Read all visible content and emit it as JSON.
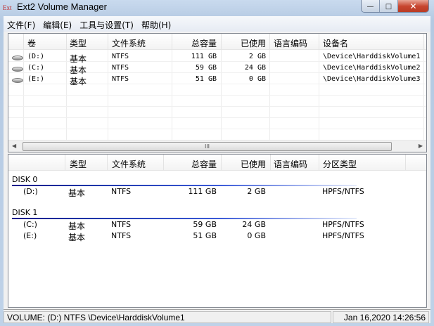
{
  "window": {
    "logo": "Ext",
    "title": "Ext2 Volume Manager",
    "minimize": "—",
    "maximize": "□",
    "close": "✕"
  },
  "menu": [
    "文件(F)",
    "编辑(E)",
    "工具与设置(T)",
    "帮助(H)"
  ],
  "volumes": {
    "headers": [
      "卷",
      "类型",
      "文件系统",
      "总容量",
      "已使用",
      "语言编码",
      "设备名"
    ],
    "rows": [
      {
        "volume": "(D:)",
        "type": "基本",
        "fs": "NTFS",
        "total": "111 GB",
        "used": "2 GB",
        "codepage": "",
        "device": "\\Device\\HarddiskVolume1"
      },
      {
        "volume": "(C:)",
        "type": "基本",
        "fs": "NTFS",
        "total": "59 GB",
        "used": "24 GB",
        "codepage": "",
        "device": "\\Device\\HarddiskVolume2"
      },
      {
        "volume": "(E:)",
        "type": "基本",
        "fs": "NTFS",
        "total": "51 GB",
        "used": "0 GB",
        "codepage": "",
        "device": "\\Device\\HarddiskVolume3"
      }
    ],
    "scroll_thumb": "III"
  },
  "disks": {
    "headers": [
      "类型",
      "文件系统",
      "总容量",
      "已使用",
      "语言编码",
      "分区类型"
    ],
    "groups": [
      {
        "name": "DISK 0",
        "rows": [
          {
            "volume": "(D:)",
            "type": "基本",
            "fs": "NTFS",
            "total": "111 GB",
            "used": "2 GB",
            "codepage": "",
            "ptype": "HPFS/NTFS"
          }
        ]
      },
      {
        "name": "DISK 1",
        "rows": [
          {
            "volume": "(C:)",
            "type": "基本",
            "fs": "NTFS",
            "total": "59 GB",
            "used": "24 GB",
            "codepage": "",
            "ptype": "HPFS/NTFS"
          },
          {
            "volume": "(E:)",
            "type": "基本",
            "fs": "NTFS",
            "total": "51 GB",
            "used": "0 GB",
            "codepage": "",
            "ptype": "HPFS/NTFS"
          }
        ]
      }
    ]
  },
  "status": {
    "left": "VOLUME: (D:) NTFS \\Device\\HarddiskVolume1",
    "right": "Jan 16,2020 14:26:56"
  }
}
